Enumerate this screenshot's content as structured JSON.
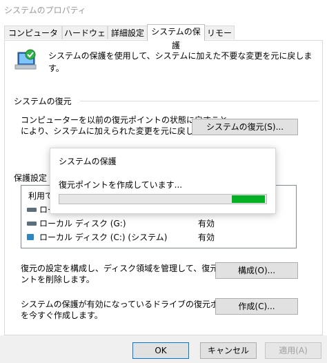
{
  "window": {
    "title": "システムのプロパティ"
  },
  "tabs": [
    {
      "label": "コンピューター名",
      "active": false
    },
    {
      "label": "ハードウェア",
      "active": false
    },
    {
      "label": "詳細設定",
      "active": false
    },
    {
      "label": "システムの保護",
      "active": true
    },
    {
      "label": "リモート",
      "active": false
    }
  ],
  "header": {
    "description": "システムの保護を使用して、システムに加えた不要な変更を元に戻します。",
    "icon": "computer-restore-icon"
  },
  "restore": {
    "heading": "システムの復元",
    "text_line1": "コンピューターを以前の復元ポイントの状態に戻すこと",
    "text_line2": "により、システムに加えられた変更を元に戻します。",
    "button": "システムの復元(S)..."
  },
  "protection": {
    "heading_visible": "保護設定",
    "list_header_visible": "利用で",
    "drives": [
      {
        "label": "ロー",
        "status": "",
        "icon": "drive-icon"
      },
      {
        "label": "ローカル ディスク (G:)",
        "status": "有効",
        "icon": "drive-icon"
      },
      {
        "label": "ローカル ディスク (C:) (システム)",
        "status": "有効",
        "icon": "system-drive-icon"
      }
    ]
  },
  "configure": {
    "text_line1": "復元の設定を構成し、ディスク領域を管理して、復元ポイ",
    "text_line2": "ントを削除します。",
    "button": "構成(O)..."
  },
  "create": {
    "text_line1": "システムの保護が有効になっているドライブの復元ポイント",
    "text_line2": "を今すぐ作成します。",
    "button": "作成(C)..."
  },
  "dialog": {
    "title": "システムの保護",
    "message": "復元ポイントを作成しています...",
    "progress_color": "#06b025"
  },
  "footer": {
    "ok": "OK",
    "cancel": "キャンセル",
    "apply": "適用(A)"
  }
}
